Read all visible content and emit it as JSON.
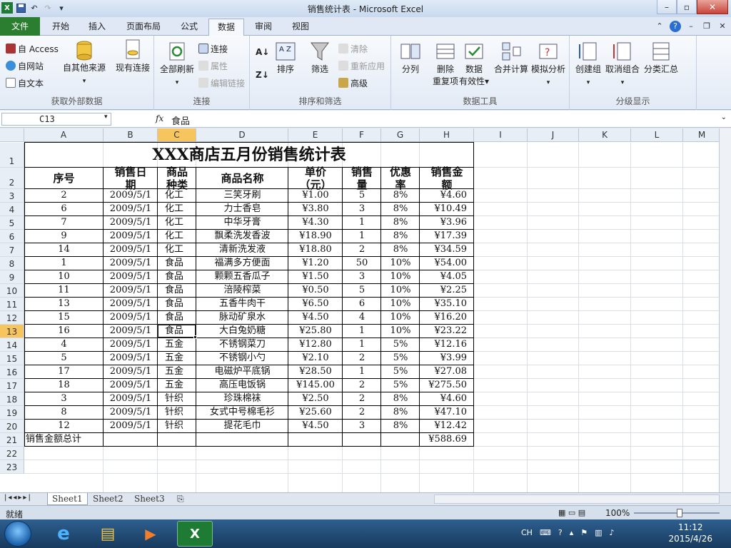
{
  "window": {
    "title": "销售统计表 - Microsoft Excel"
  },
  "tabs": [
    "文件",
    "开始",
    "插入",
    "页面布局",
    "公式",
    "数据",
    "审阅",
    "视图"
  ],
  "ribbon": {
    "group_external": {
      "label": "获取外部数据",
      "access": "自 Access",
      "web": "自网站",
      "text": "自文本",
      "other": "自其他来源",
      "existing": "现有连接"
    },
    "group_connections": {
      "label": "连接",
      "refresh_all": "全部刷新",
      "connections": "连接",
      "properties": "属性",
      "edit_links": "编辑链接"
    },
    "group_sort": {
      "label": "排序和筛选",
      "sort": "排序",
      "filter": "筛选",
      "clear": "清除",
      "reapply": "重新应用",
      "advanced": "高级"
    },
    "group_tools": {
      "label": "数据工具",
      "split": "分列",
      "remove_dup_1": "删除",
      "remove_dup_2": "重复项",
      "validation_1": "数据",
      "validation_2": "有效性",
      "consolidate": "合并计算",
      "whatif": "模拟分析"
    },
    "group_outline": {
      "label": "分级显示",
      "group": "创建组",
      "ungroup": "取消组合",
      "subtotal": "分类汇总"
    }
  },
  "formula_bar": {
    "name_box": "C13",
    "fx": "fx",
    "content": "食品"
  },
  "columns": [
    "A",
    "B",
    "C",
    "D",
    "E",
    "F",
    "G",
    "H",
    "I",
    "J",
    "K",
    "L",
    "M"
  ],
  "rows_hdr": [
    "1",
    "2",
    "3",
    "4",
    "5",
    "6",
    "7",
    "8",
    "9",
    "10",
    "11",
    "12",
    "13",
    "14",
    "15",
    "16",
    "17",
    "18",
    "19",
    "20",
    "21",
    "22",
    "23"
  ],
  "sheet": {
    "title": "XXX商店五月份销售统计表",
    "headers": [
      [
        "序号"
      ],
      [
        "销售日",
        "期"
      ],
      [
        "商品",
        "种类"
      ],
      [
        "商品名称"
      ],
      [
        "单价",
        "（元）"
      ],
      [
        "销售",
        "量"
      ],
      [
        "优惠",
        "率"
      ],
      [
        "销售金",
        "额"
      ]
    ],
    "rows": [
      [
        "2",
        "2009/5/1",
        "化工",
        "三笑牙刷",
        "¥1.00",
        "5",
        "8%",
        "¥4.60"
      ],
      [
        "6",
        "2009/5/1",
        "化工",
        "力士香皂",
        "¥3.80",
        "3",
        "8%",
        "¥10.49"
      ],
      [
        "7",
        "2009/5/1",
        "化工",
        "中华牙膏",
        "¥4.30",
        "1",
        "8%",
        "¥3.96"
      ],
      [
        "9",
        "2009/5/1",
        "化工",
        "飘柔洗发香波",
        "¥18.90",
        "1",
        "8%",
        "¥17.39"
      ],
      [
        "14",
        "2009/5/1",
        "化工",
        "清新洗发液",
        "¥18.80",
        "2",
        "8%",
        "¥34.59"
      ],
      [
        "1",
        "2009/5/1",
        "食品",
        "福满多方便面",
        "¥1.20",
        "50",
        "10%",
        "¥54.00"
      ],
      [
        "10",
        "2009/5/1",
        "食品",
        "颗颗五香瓜子",
        "¥1.50",
        "3",
        "10%",
        "¥4.05"
      ],
      [
        "11",
        "2009/5/1",
        "食品",
        "涪陵榨菜",
        "¥0.50",
        "5",
        "10%",
        "¥2.25"
      ],
      [
        "13",
        "2009/5/1",
        "食品",
        "五香牛肉干",
        "¥6.50",
        "6",
        "10%",
        "¥35.10"
      ],
      [
        "15",
        "2009/5/1",
        "食品",
        "脉动矿泉水",
        "¥4.50",
        "4",
        "10%",
        "¥16.20"
      ],
      [
        "16",
        "2009/5/1",
        "食品",
        "大白兔奶糖",
        "¥25.80",
        "1",
        "10%",
        "¥23.22"
      ],
      [
        "4",
        "2009/5/1",
        "五金",
        "不锈钢菜刀",
        "¥12.80",
        "1",
        "5%",
        "¥12.16"
      ],
      [
        "5",
        "2009/5/1",
        "五金",
        "不锈钢小勺",
        "¥2.10",
        "2",
        "5%",
        "¥3.99"
      ],
      [
        "17",
        "2009/5/1",
        "五金",
        "电磁炉平底锅",
        "¥28.50",
        "1",
        "5%",
        "¥27.08"
      ],
      [
        "18",
        "2009/5/1",
        "五金",
        "高压电饭锅",
        "¥145.00",
        "2",
        "5%",
        "¥275.50"
      ],
      [
        "3",
        "2009/5/1",
        "针织",
        "珍珠棉袜",
        "¥2.50",
        "2",
        "8%",
        "¥4.60"
      ],
      [
        "8",
        "2009/5/1",
        "针织",
        "女式中号棉毛衫",
        "¥25.60",
        "2",
        "8%",
        "¥47.10"
      ],
      [
        "12",
        "2009/5/1",
        "针织",
        "提花毛巾",
        "¥4.50",
        "3",
        "8%",
        "¥12.42"
      ]
    ],
    "total_label": "销售金额总计",
    "total_value": "¥588.69"
  },
  "sheet_tabs": [
    "Sheet1",
    "Sheet2",
    "Sheet3"
  ],
  "status": {
    "ready": "就绪",
    "zoom": "100%"
  },
  "taskbar": {
    "time": "11:12",
    "date": "2015/4/26",
    "lang": "CH"
  },
  "colors": {
    "file_tab": "#2b7d2f",
    "selection": "#f7c55d"
  }
}
